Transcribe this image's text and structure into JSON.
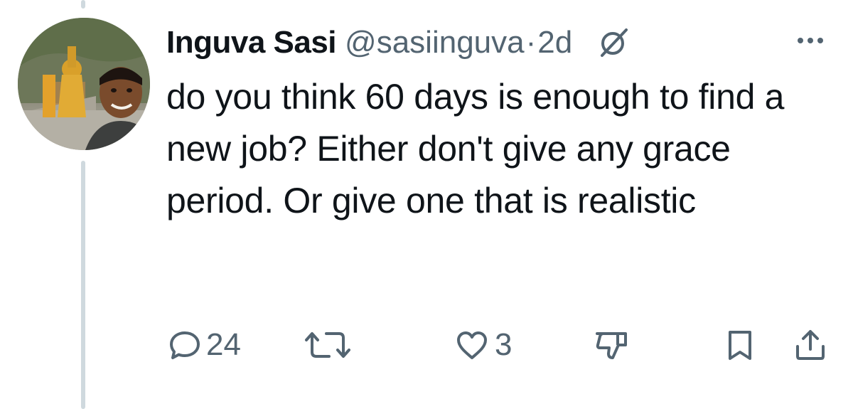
{
  "author": {
    "name": "Inguva Sasi",
    "handle": "@sasiinguva",
    "separator": "·",
    "time": "2d"
  },
  "tweet": {
    "text": "do you think 60 days is enough to find a new job? Either don't give any grace period. Or give one that is realistic"
  },
  "actions": {
    "reply_count": "24",
    "retweet_count": "",
    "like_count": "3"
  },
  "icons": [
    "grok-icon",
    "more-icon",
    "reply-icon",
    "retweet-icon",
    "like-icon",
    "dislike-icon",
    "bookmark-icon",
    "share-icon"
  ],
  "colors": {
    "text": "#0f1419",
    "muted": "#536471",
    "thread_line": "#cfd9de",
    "background": "#ffffff"
  }
}
